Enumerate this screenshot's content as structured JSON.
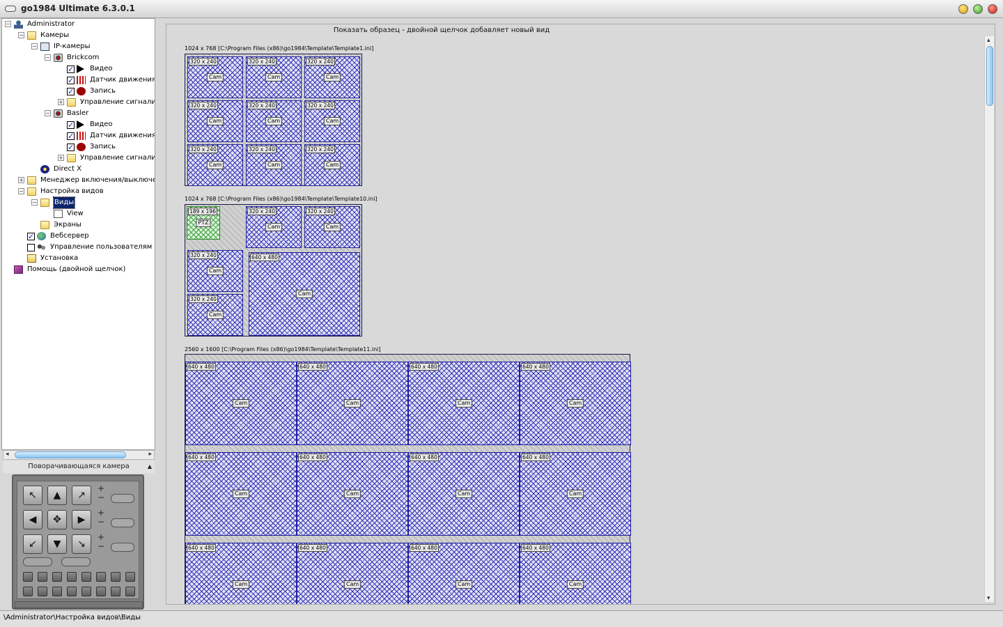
{
  "window": {
    "title": "go1984 Ultimate 6.3.0.1"
  },
  "tree": [
    {
      "label": "Administrator",
      "depth": 0,
      "icon": "user-icon",
      "expander": "-"
    },
    {
      "label": "Камеры",
      "depth": 1,
      "icon": "folder-icon",
      "expander": "-"
    },
    {
      "label": "IP-камеры",
      "depth": 2,
      "icon": "network-camera-icon",
      "expander": "-"
    },
    {
      "label": "Brickcom",
      "depth": 3,
      "icon": "camera-icon",
      "expander": "-"
    },
    {
      "label": "Видео",
      "depth": 4,
      "icon": "play-icon",
      "checked": true
    },
    {
      "label": "Датчик движения",
      "depth": 4,
      "icon": "motion-icon",
      "checked": true
    },
    {
      "label": "Запись",
      "depth": 4,
      "icon": "record-icon",
      "checked": true
    },
    {
      "label": "Управление сигнали",
      "depth": 4,
      "icon": "folder-icon",
      "expander": "+"
    },
    {
      "label": "Basler",
      "depth": 3,
      "icon": "camera-icon",
      "expander": "-"
    },
    {
      "label": "Видео",
      "depth": 4,
      "icon": "play-icon",
      "checked": true
    },
    {
      "label": "Датчик движения",
      "depth": 4,
      "icon": "motion-icon",
      "checked": true
    },
    {
      "label": "Запись",
      "depth": 4,
      "icon": "record-icon",
      "checked": true
    },
    {
      "label": "Управление сигнали",
      "depth": 4,
      "icon": "folder-icon",
      "expander": "+"
    },
    {
      "label": "Direct X",
      "depth": 2,
      "icon": "directx-icon"
    },
    {
      "label": "Менеджер включения/выключе",
      "depth": 1,
      "icon": "folder-icon",
      "expander": "+"
    },
    {
      "label": "Настройка видов",
      "depth": 1,
      "icon": "folder-icon",
      "expander": "-"
    },
    {
      "label": "Виды",
      "depth": 2,
      "icon": "folder-icon",
      "expander": "-",
      "selected": true
    },
    {
      "label": "View",
      "depth": 3,
      "icon": "grid-icon"
    },
    {
      "label": "Экраны",
      "depth": 2,
      "icon": "folder-icon"
    },
    {
      "label": "Вебсервер",
      "depth": 1,
      "icon": "globe-icon",
      "checked": true
    },
    {
      "label": "Управление пользователям",
      "depth": 1,
      "icon": "users-icon",
      "checked": false
    },
    {
      "label": "Установка",
      "depth": 1,
      "icon": "setup-icon"
    },
    {
      "label": "Помощь (двойной щелчок)",
      "depth": 0,
      "icon": "help-book-icon"
    }
  ],
  "ptz": {
    "title": "Поворачивающаяся камера",
    "arrows": [
      "↖",
      "▲",
      "↗",
      "◀",
      "✥",
      "▶",
      "↙",
      "▼",
      "↘"
    ],
    "plus": "+",
    "minus": "−"
  },
  "status": {
    "path": "\\Administrator\\Настройка видов\\Виды"
  },
  "preview": {
    "header": "Показать образец - двойной щелчок добавляет новый вид",
    "templates": [
      {
        "label": "1024 x 768 [C:\\Program Files (x86)\\go1984\\Template\\Template1.ini]",
        "cells": [
          {
            "size": "320 x 240",
            "text": "Cam"
          },
          {
            "size": "320 x 240",
            "text": "Cam"
          },
          {
            "size": "320 x 240",
            "text": "Cam"
          },
          {
            "size": "320 x 240",
            "text": "Cam"
          },
          {
            "size": "320 x 240",
            "text": "Cam"
          },
          {
            "size": "320 x 240",
            "text": "Cam"
          },
          {
            "size": "320 x 240",
            "text": "Cam"
          },
          {
            "size": "320 x 240",
            "text": "Cam"
          },
          {
            "size": "320 x 240",
            "text": "Cam"
          }
        ]
      },
      {
        "label": "1024 x 768 [C:\\Program Files (x86)\\go1984\\Template\\Template10.ini]",
        "cells": [
          {
            "size": "189 x 196",
            "text": "PTZ",
            "ptz": true
          },
          {
            "size": "320 x 240",
            "text": "Cam"
          },
          {
            "size": "320 x 240",
            "text": "Cam"
          },
          {
            "size": "320 x 240",
            "text": "Cam"
          },
          {
            "size": "640 x 480",
            "text": "Cam"
          },
          {
            "size": "320 x 240",
            "text": "Cam"
          }
        ]
      },
      {
        "label": "2560 x 1600 [C:\\Program Files (x86)\\go1984\\Template\\Template11.ini]",
        "cells": [
          {
            "size": "640 x 480",
            "text": "Cam"
          },
          {
            "size": "640 x 480",
            "text": "Cam"
          },
          {
            "size": "640 x 480",
            "text": "Cam"
          },
          {
            "size": "640 x 480",
            "text": "Cam"
          },
          {
            "size": "640 x 480",
            "text": "Cam"
          },
          {
            "size": "640 x 480",
            "text": "Cam"
          },
          {
            "size": "640 x 480",
            "text": "Cam"
          },
          {
            "size": "640 x 480",
            "text": "Cam"
          },
          {
            "size": "640 x 480",
            "text": "Cam"
          },
          {
            "size": "640 x 480",
            "text": "Cam"
          },
          {
            "size": "640 x 480",
            "text": "Cam"
          },
          {
            "size": "640 x 480",
            "text": "Cam"
          }
        ]
      }
    ]
  }
}
